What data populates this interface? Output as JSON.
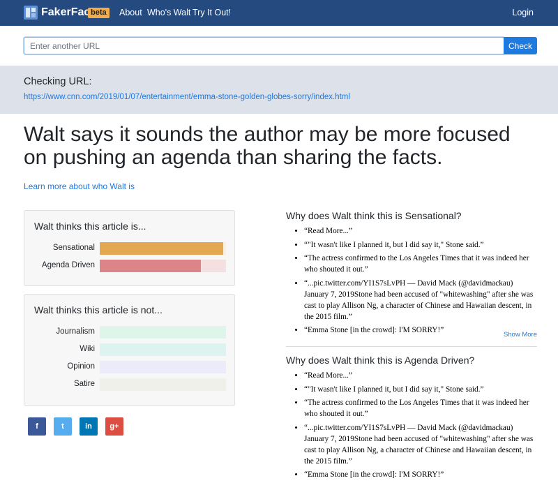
{
  "nav": {
    "brand": "FakerFact",
    "beta": "beta",
    "links": [
      "About",
      "Who's Walt",
      "Try It Out!"
    ],
    "login": "Login"
  },
  "search": {
    "placeholder": "Enter another URL",
    "button": "Check"
  },
  "checking": {
    "label": "Checking URL:",
    "url": "https://www.cnn.com/2019/01/07/entertainment/emma-stone-golden-globes-sorry/index.html"
  },
  "headline": "Walt says it sounds the author may be more focused on pushing an agenda than sharing the facts.",
  "learn_more": "Learn more about who Walt is",
  "thinks_is": {
    "title": "Walt thinks this article is...",
    "bars": [
      {
        "label": "Sensational",
        "value": 0.98,
        "color": "#e4a850",
        "track": "#fbeedd"
      },
      {
        "label": "Agenda Driven",
        "value": 0.8,
        "color": "#dc8589",
        "track": "#f4e0e0"
      }
    ]
  },
  "thinks_not": {
    "title": "Walt thinks this article is not...",
    "bars": [
      {
        "label": "Journalism",
        "value": 0.0,
        "color": "#8fd8b3",
        "track": "#def5e9"
      },
      {
        "label": "Wiki",
        "value": 0.0,
        "color": "#8fd8cf",
        "track": "#ddf3ef"
      },
      {
        "label": "Opinion",
        "value": 0.0,
        "color": "#bcb8ec",
        "track": "#ebebfa"
      },
      {
        "label": "Satire",
        "value": 0.0,
        "color": "#d6d3c4",
        "track": "#f0f0ea"
      }
    ]
  },
  "social": [
    {
      "name": "facebook",
      "glyph": "f"
    },
    {
      "name": "twitter",
      "glyph": "t"
    },
    {
      "name": "linkedin",
      "glyph": "in"
    },
    {
      "name": "google-plus",
      "glyph": "g+"
    }
  ],
  "sensational": {
    "title": "Why does Walt think this is Sensational?",
    "quotes": [
      "“Read More...”",
      "“\"It wasn't like I planned it, but I did say it,\" Stone said.”",
      "“The actress confirmed to the Los Angeles Times that it was indeed her who shouted it out.”",
      "“...pic.twitter.com/YI1S7sLvPH — David Mack (@davidmackau) January 7, 2019Stone had been accused of \"whitewashing\" after she was cast to play Allison Ng, a character of Chinese and Hawaiian descent, in the 2015 film.”",
      "“Emma Stone [in the crowd]: I'M SORRY!”"
    ],
    "show_more": "Show More"
  },
  "agenda": {
    "title": "Why does Walt think this is Agenda Driven?",
    "quotes": [
      "“Read More...”",
      "“\"It wasn't like I planned it, but I did say it,\" Stone said.”",
      "“The actress confirmed to the Los Angeles Times that it was indeed her who shouted it out.”",
      "“...pic.twitter.com/YI1S7sLvPH — David Mack (@davidmackau) January 7, 2019Stone had been accused of \"whitewashing\" after she was cast to play Allison Ng, a character of Chinese and Hawaiian descent, in the 2015 film.”",
      "“Emma Stone [in the crowd]: I'M SORRY!”"
    ]
  }
}
